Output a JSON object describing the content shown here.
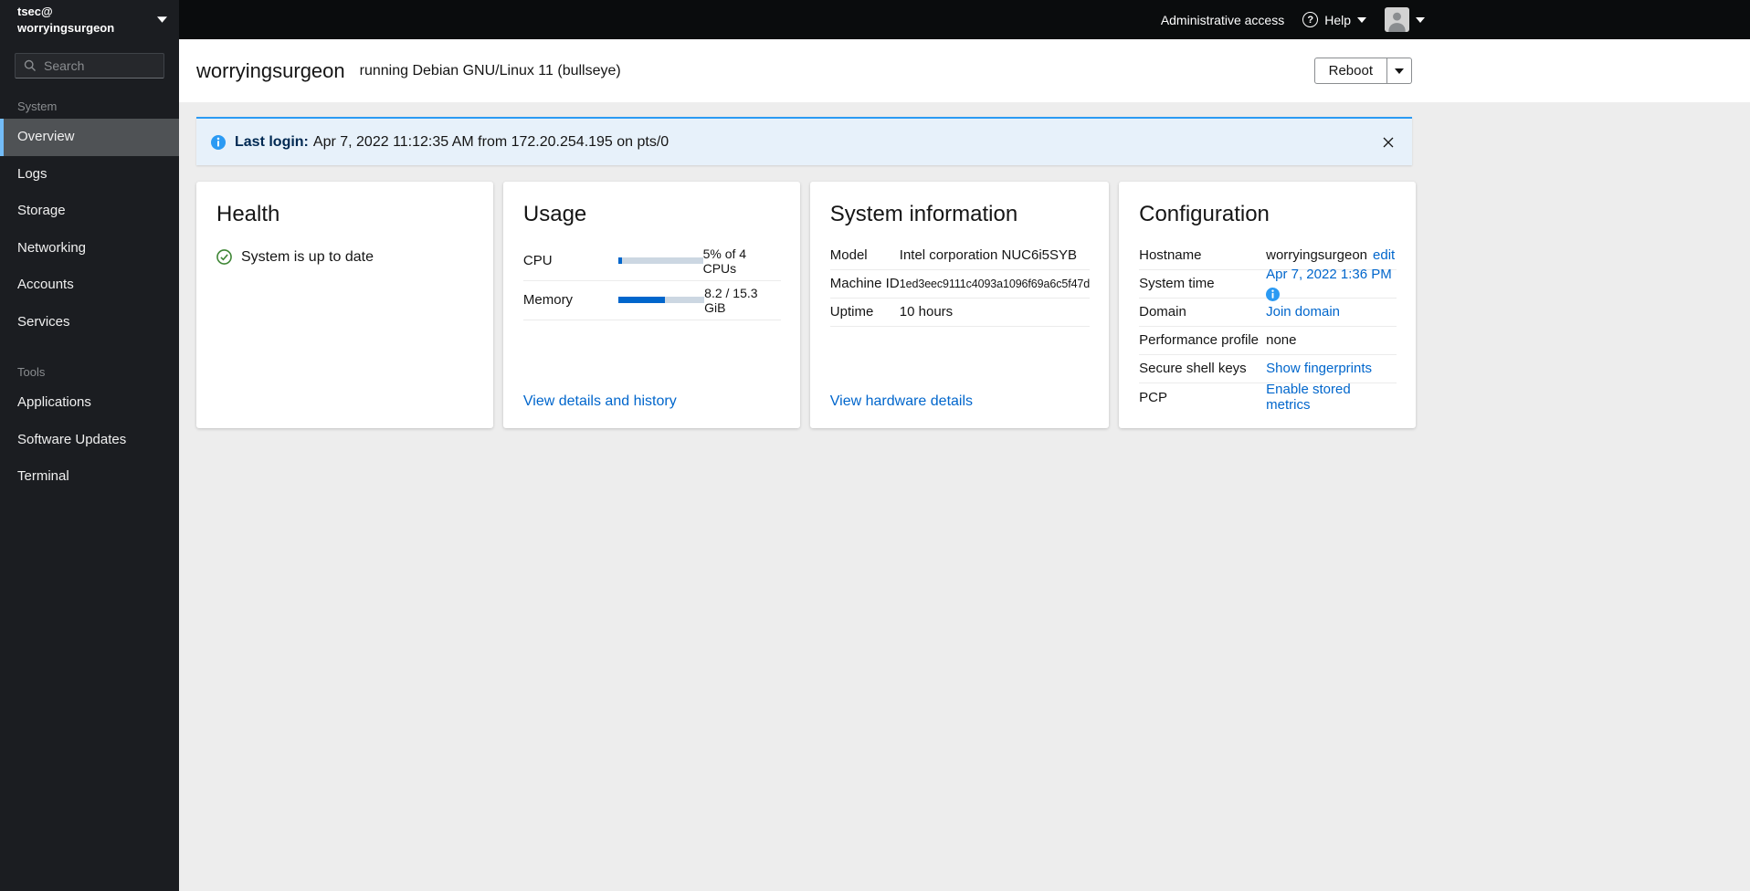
{
  "masthead": {
    "user": "tsec@",
    "host": "worryingsurgeon",
    "admin_access_label": "Administrative access",
    "help_label": "Help"
  },
  "sidebar": {
    "search_placeholder": "Search",
    "groups": [
      {
        "label": "System",
        "items": [
          {
            "label": "Overview",
            "selected": true
          },
          {
            "label": "Logs",
            "selected": false
          },
          {
            "label": "Storage",
            "selected": false
          },
          {
            "label": "Networking",
            "selected": false
          },
          {
            "label": "Accounts",
            "selected": false
          },
          {
            "label": "Services",
            "selected": false
          }
        ]
      },
      {
        "label": "Tools",
        "items": [
          {
            "label": "Applications",
            "selected": false
          },
          {
            "label": "Software Updates",
            "selected": false
          },
          {
            "label": "Terminal",
            "selected": false
          }
        ]
      }
    ]
  },
  "header": {
    "hostname": "worryingsurgeon",
    "os": "running Debian GNU/Linux 11 (bullseye)",
    "reboot_label": "Reboot"
  },
  "alert": {
    "title": "Last login:",
    "message": "Apr 7, 2022 11:12:35 AM from 172.20.254.195 on pts/0"
  },
  "cards": {
    "health": {
      "title": "Health",
      "status": "System is up to date"
    },
    "usage": {
      "title": "Usage",
      "rows": [
        {
          "label": "CPU",
          "percent": 5,
          "value": "5% of 4 CPUs"
        },
        {
          "label": "Memory",
          "percent": 54,
          "value": "8.2 / 15.3 GiB"
        }
      ],
      "link": "View details and history"
    },
    "system_information": {
      "title": "System information",
      "rows": [
        {
          "label": "Model",
          "value": "Intel corporation NUC6i5SYB"
        },
        {
          "label": "Machine ID",
          "value": "1ed3eec9111c4093a1096f69a6c5f47d"
        },
        {
          "label": "Uptime",
          "value": "10 hours"
        }
      ],
      "link": "View hardware details"
    },
    "configuration": {
      "title": "Configuration",
      "rows": [
        {
          "label": "Hostname",
          "value": "worryingsurgeon",
          "link": "edit"
        },
        {
          "label": "System time",
          "link": "Apr 7, 2022 1:36 PM",
          "has_info_icon": true
        },
        {
          "label": "Domain",
          "link": "Join domain"
        },
        {
          "label": "Performance profile",
          "value": "none"
        },
        {
          "label": "Secure shell keys",
          "link": "Show fingerprints"
        },
        {
          "label": "PCP",
          "link": "Enable stored metrics"
        }
      ]
    }
  },
  "colors": {
    "link_blue": "#0066cc",
    "info_blue": "#2b9af3",
    "success_green": "#3e8635",
    "nav_selected_accent": "#73bcf7",
    "sidebar_bg": "#1b1d21",
    "masthead_bg": "#0a0c0d",
    "content_bg": "#ededed",
    "alert_bg": "#e7f1fa"
  }
}
